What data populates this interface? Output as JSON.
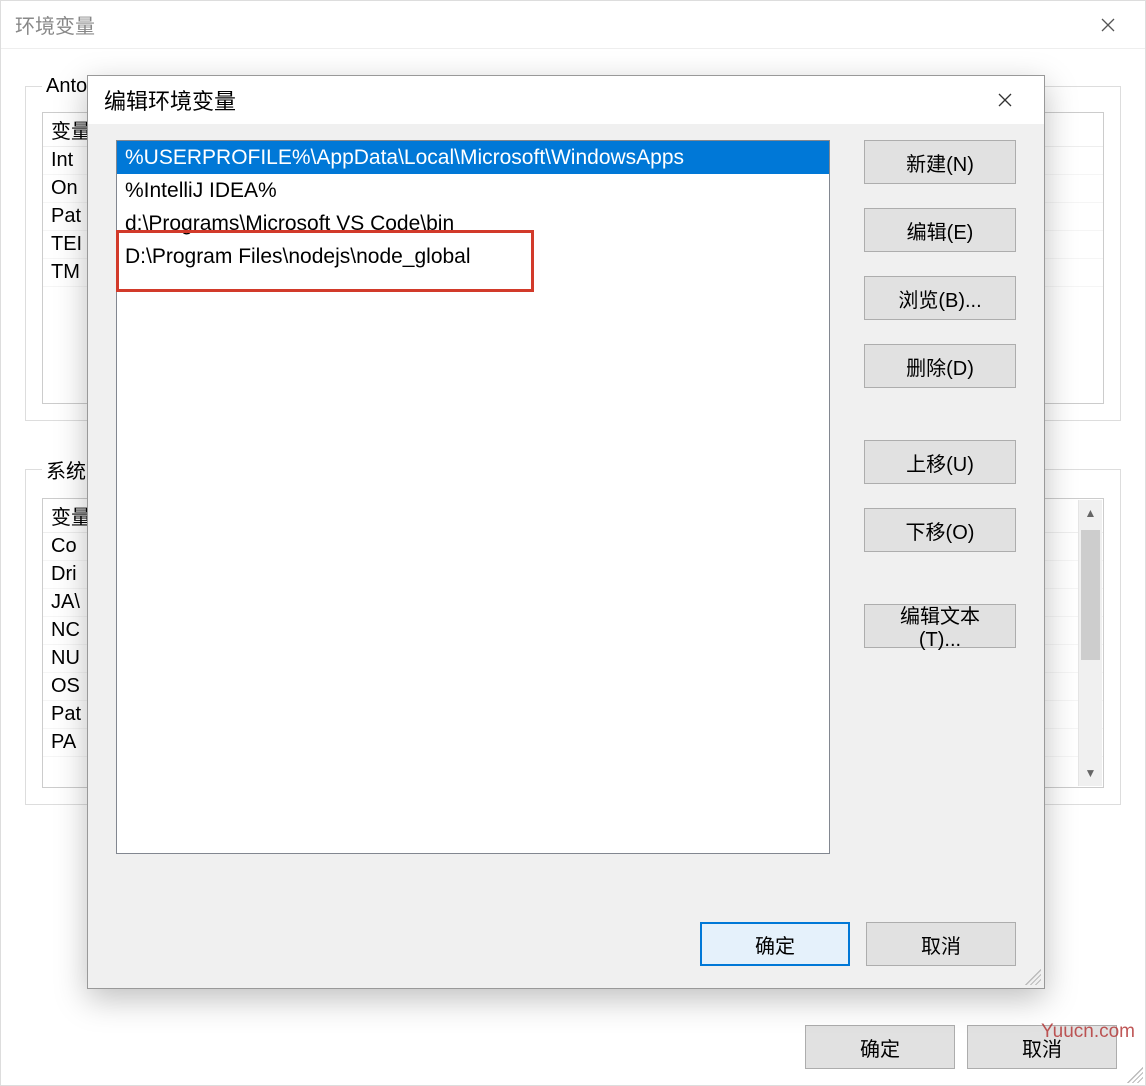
{
  "outer": {
    "title": "环境变量",
    "close_aria": "Close",
    "user_group": "Anto",
    "user_header_col1": "变量",
    "user_vars": [
      "Int",
      "On",
      "Pat",
      "TEI",
      "TM"
    ],
    "system_group": "系统变",
    "system_header_col1": "变量",
    "system_vars": [
      "Co",
      "Dri",
      "JA\\",
      "NC",
      "NU",
      "OS",
      "Pat",
      "PA"
    ],
    "ok_label": "确定",
    "cancel_label": "取消",
    "watermark": "Yuucn.com"
  },
  "modal": {
    "title": "编辑环境变量",
    "close_aria": "Close",
    "paths": [
      "%USERPROFILE%\\AppData\\Local\\Microsoft\\WindowsApps",
      "%IntelliJ IDEA%",
      "d:\\Programs\\Microsoft VS Code\\bin",
      "D:\\Program Files\\nodejs\\node_global"
    ],
    "selected_index": 0,
    "highlight_index": 3,
    "buttons": {
      "new": "新建(N)",
      "edit": "编辑(E)",
      "browse": "浏览(B)...",
      "delete": "删除(D)",
      "move_up": "上移(U)",
      "move_down": "下移(O)",
      "edit_text": "编辑文本(T)..."
    },
    "ok_label": "确定",
    "cancel_label": "取消"
  }
}
